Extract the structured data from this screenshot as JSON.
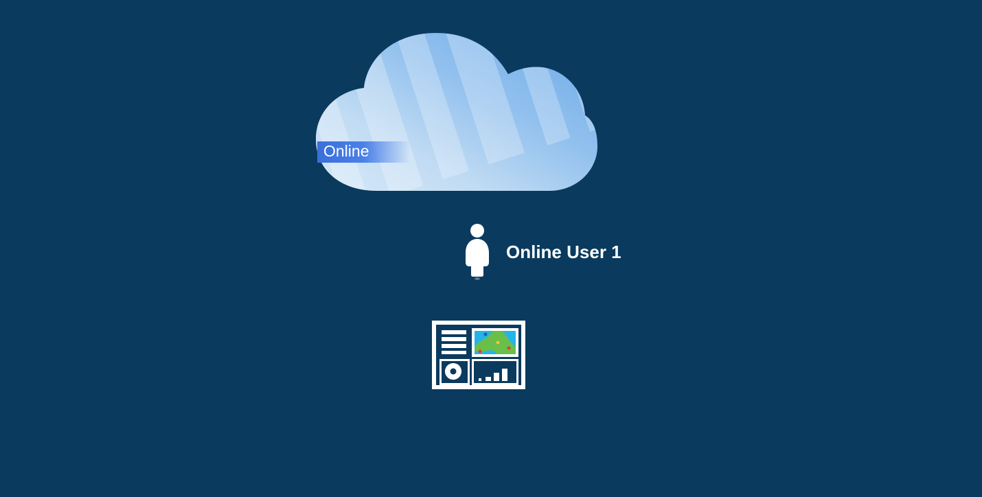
{
  "diagram": {
    "cloud": {
      "label": "Online"
    },
    "user": {
      "label": "Online User 1",
      "icon": "person-icon"
    },
    "dashboard": {
      "icon": "dashboard-icon"
    },
    "colors": {
      "background": "#0a3a5e",
      "cloudLight": "#c0dbf3",
      "cloudDark": "#6aa9e8",
      "labelBg": "#3a6fdb",
      "text": "#ffffff"
    }
  }
}
